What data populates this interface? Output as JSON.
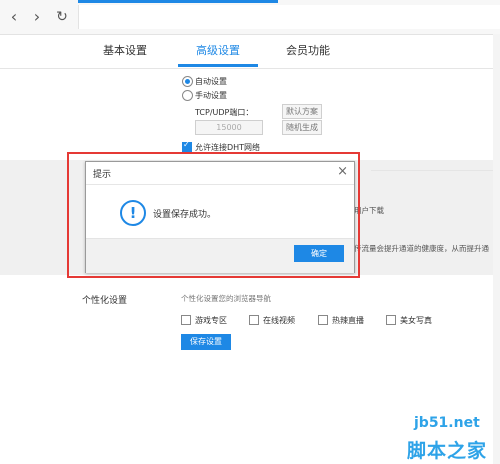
{
  "browser": {
    "back_icon": "‹",
    "forward_icon": "›",
    "refresh_icon": "↻"
  },
  "tabs": [
    {
      "label": "基本设置"
    },
    {
      "label": "高级设置"
    },
    {
      "label": "会员功能"
    }
  ],
  "settings": {
    "radio_auto": "自动设置",
    "radio_manual": "手动设置",
    "port_label": "TCP/UDP端口：",
    "default_button": "默认方案",
    "port_value": "15000",
    "random_button": "随机生成",
    "dht_label": "允许连接DHT网络"
  },
  "background_text": {
    "line1": "用户下载",
    "line2": "传流量会提升通道的健康度，从而提升通"
  },
  "dialog": {
    "title": "提示",
    "close": "×",
    "icon": "!",
    "message": "设置保存成功。",
    "ok_button": "确定"
  },
  "personalization": {
    "section_label": "个性化设置",
    "hint": "个性化设置您的浏览器导航",
    "options": [
      {
        "label": "游戏专区"
      },
      {
        "label": "在线视频"
      },
      {
        "label": "热辣直播"
      },
      {
        "label": "美女写真"
      }
    ],
    "save_button": "保存设置"
  },
  "watermark": {
    "line1": "jb51.net",
    "line2": "脚本之家"
  }
}
